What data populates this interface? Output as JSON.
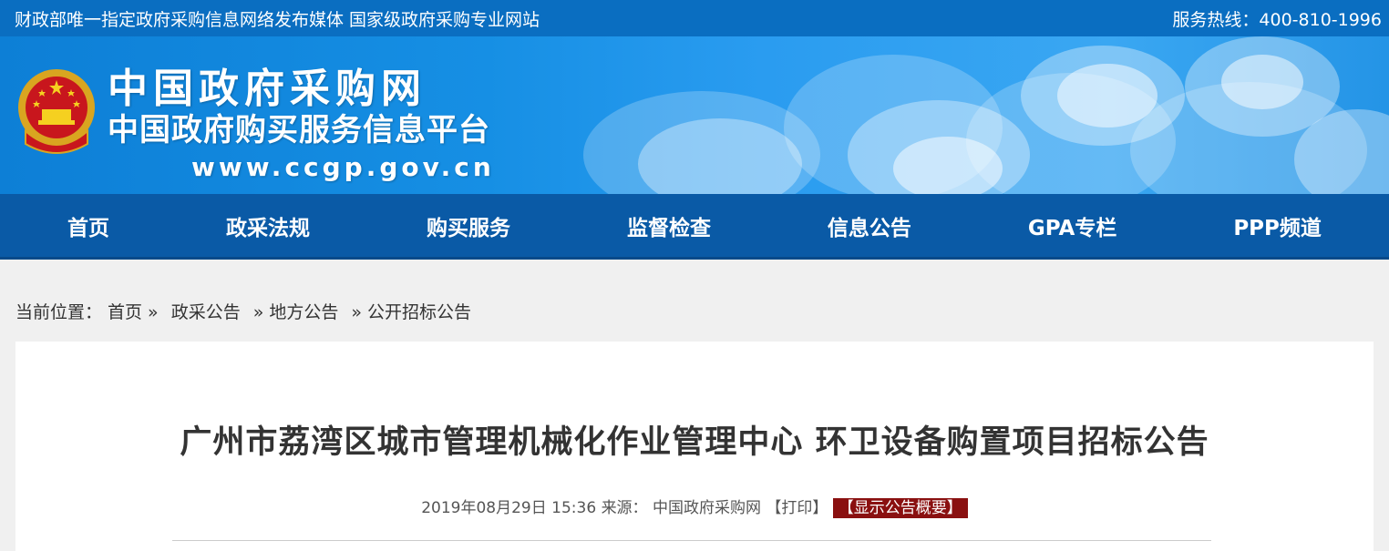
{
  "topbar": {
    "slogan": "财政部唯一指定政府采购信息网络发布媒体 国家级政府采购专业网站",
    "hotline": "服务热线：400-810-1996"
  },
  "banner": {
    "emblem_icon": "national-emblem-icon",
    "title_line1": "中国政府采购网",
    "title_line2": "中国政府购买服务信息平台",
    "url": "www.ccgp.gov.cn"
  },
  "nav": {
    "items": [
      {
        "label": "首页"
      },
      {
        "label": "政采法规"
      },
      {
        "label": "购买服务"
      },
      {
        "label": "监督检查"
      },
      {
        "label": "信息公告"
      },
      {
        "label": "GPA专栏"
      },
      {
        "label": "PPP频道"
      }
    ]
  },
  "breadcrumb": {
    "prefix": "当前位置：",
    "items": [
      "首页 »",
      "政采公告",
      "» 地方公告",
      "» 公开招标公告"
    ]
  },
  "article": {
    "title": "广州市荔湾区城市管理机械化作业管理中心 环卫设备购置项目招标公告",
    "datetime": "2019年08月29日 15:36",
    "source_label": "来源：",
    "source": "中国政府采购网",
    "print_label": "【打印】",
    "summary_label": "【显示公告概要】"
  },
  "colors": {
    "topbar_bg": "#0a6ec1",
    "nav_bg": "#0a5aa6",
    "badge_bg": "#8a1010"
  }
}
